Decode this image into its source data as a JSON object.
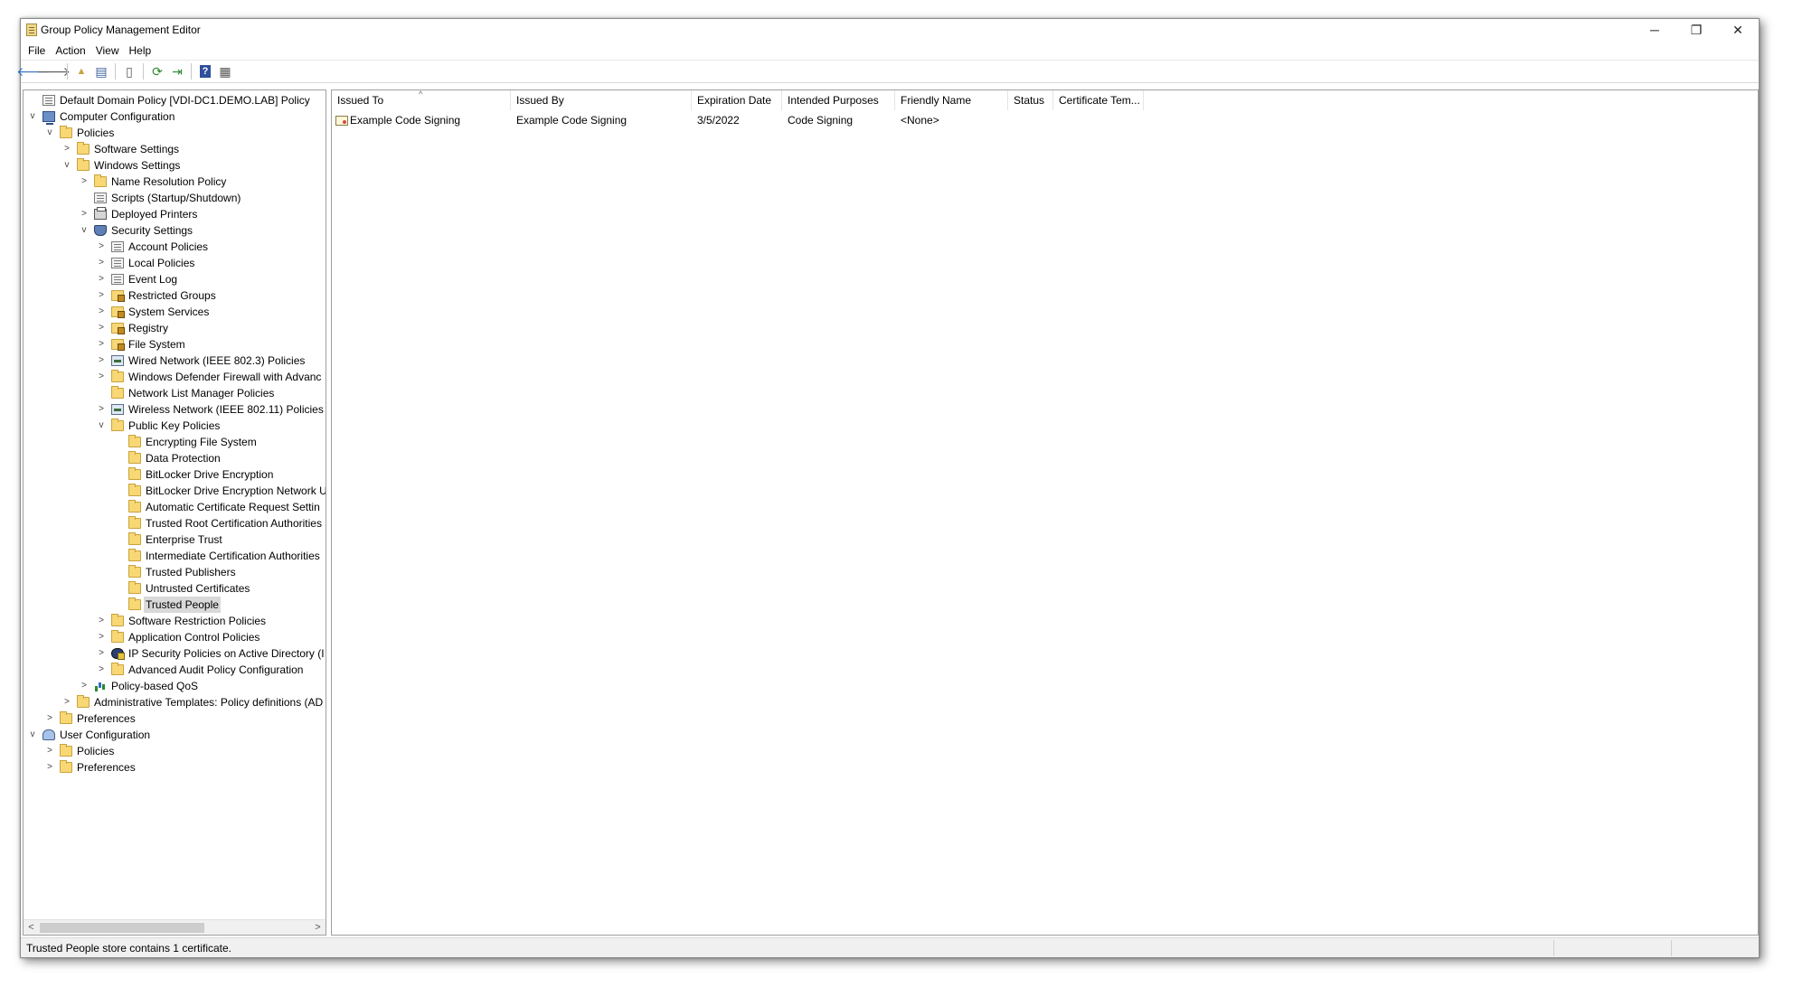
{
  "window": {
    "title": "Group Policy Management Editor",
    "controls": {
      "minimize": "─",
      "maximize": "❐",
      "close": "✕"
    }
  },
  "menu": {
    "file": "File",
    "action": "Action",
    "view": "View",
    "help": "Help"
  },
  "toolbar": {
    "back": "🡐",
    "forward": "🡒",
    "up": "▲",
    "show_tree": "▤",
    "properties": "▯",
    "refresh": "⟳",
    "export": "⇥",
    "help": "?",
    "view": "▦"
  },
  "tree": [
    {
      "label": "Default Domain Policy [VDI-DC1.DEMO.LAB] Policy",
      "icon": "doc",
      "depth": 0,
      "expander": ""
    },
    {
      "label": "Computer Configuration",
      "icon": "computer",
      "depth": 0,
      "expander": "v"
    },
    {
      "label": "Policies",
      "icon": "folder",
      "depth": 1,
      "expander": "v"
    },
    {
      "label": "Software Settings",
      "icon": "folder",
      "depth": 2,
      "expander": ">"
    },
    {
      "label": "Windows Settings",
      "icon": "folder",
      "depth": 2,
      "expander": "v"
    },
    {
      "label": "Name Resolution Policy",
      "icon": "folder",
      "depth": 3,
      "expander": ">"
    },
    {
      "label": "Scripts (Startup/Shutdown)",
      "icon": "doc",
      "depth": 3,
      "expander": ""
    },
    {
      "label": "Deployed Printers",
      "icon": "printer",
      "depth": 3,
      "expander": ">"
    },
    {
      "label": "Security Settings",
      "icon": "shield",
      "depth": 3,
      "expander": "v"
    },
    {
      "label": "Account Policies",
      "icon": "doc",
      "depth": 4,
      "expander": ">"
    },
    {
      "label": "Local Policies",
      "icon": "doc",
      "depth": 4,
      "expander": ">"
    },
    {
      "label": "Event Log",
      "icon": "doc",
      "depth": 4,
      "expander": ">"
    },
    {
      "label": "Restricted Groups",
      "icon": "lockfolder",
      "depth": 4,
      "expander": ">"
    },
    {
      "label": "System Services",
      "icon": "lockfolder",
      "depth": 4,
      "expander": ">"
    },
    {
      "label": "Registry",
      "icon": "lockfolder",
      "depth": 4,
      "expander": ">"
    },
    {
      "label": "File System",
      "icon": "lockfolder",
      "depth": 4,
      "expander": ">"
    },
    {
      "label": "Wired Network (IEEE 802.3) Policies",
      "icon": "net",
      "depth": 4,
      "expander": ">"
    },
    {
      "label": "Windows Defender Firewall with Advanc",
      "icon": "folder",
      "depth": 4,
      "expander": ">"
    },
    {
      "label": "Network List Manager Policies",
      "icon": "folder",
      "depth": 4,
      "expander": ""
    },
    {
      "label": "Wireless Network (IEEE 802.11) Policies",
      "icon": "net",
      "depth": 4,
      "expander": ">"
    },
    {
      "label": "Public Key Policies",
      "icon": "folder",
      "depth": 4,
      "expander": "v"
    },
    {
      "label": "Encrypting File System",
      "icon": "folder",
      "depth": 5,
      "expander": ""
    },
    {
      "label": "Data Protection",
      "icon": "folder",
      "depth": 5,
      "expander": ""
    },
    {
      "label": "BitLocker Drive Encryption",
      "icon": "folder",
      "depth": 5,
      "expander": ""
    },
    {
      "label": "BitLocker Drive Encryption Network U",
      "icon": "folder",
      "depth": 5,
      "expander": ""
    },
    {
      "label": "Automatic Certificate Request Settin",
      "icon": "folder",
      "depth": 5,
      "expander": ""
    },
    {
      "label": "Trusted Root Certification Authorities",
      "icon": "folder",
      "depth": 5,
      "expander": ""
    },
    {
      "label": "Enterprise Trust",
      "icon": "folder",
      "depth": 5,
      "expander": ""
    },
    {
      "label": "Intermediate Certification Authorities",
      "icon": "folder",
      "depth": 5,
      "expander": ""
    },
    {
      "label": "Trusted Publishers",
      "icon": "folder",
      "depth": 5,
      "expander": ""
    },
    {
      "label": "Untrusted Certificates",
      "icon": "folder",
      "depth": 5,
      "expander": ""
    },
    {
      "label": "Trusted People",
      "icon": "folder",
      "depth": 5,
      "expander": "",
      "selected": true
    },
    {
      "label": "Software Restriction Policies",
      "icon": "folder",
      "depth": 4,
      "expander": ">"
    },
    {
      "label": "Application Control Policies",
      "icon": "folder",
      "depth": 4,
      "expander": ">"
    },
    {
      "label": "IP Security Policies on Active Directory (I",
      "icon": "ipsec",
      "depth": 4,
      "expander": ">"
    },
    {
      "label": "Advanced Audit Policy Configuration",
      "icon": "folder",
      "depth": 4,
      "expander": ">"
    },
    {
      "label": "Policy-based QoS",
      "icon": "chart",
      "depth": 3,
      "expander": ">"
    },
    {
      "label": "Administrative Templates: Policy definitions (AD",
      "icon": "folder",
      "depth": 2,
      "expander": ">"
    },
    {
      "label": "Preferences",
      "icon": "folder",
      "depth": 1,
      "expander": ">"
    },
    {
      "label": "User Configuration",
      "icon": "user",
      "depth": 0,
      "expander": "v"
    },
    {
      "label": "Policies",
      "icon": "folder",
      "depth": 1,
      "expander": ">"
    },
    {
      "label": "Preferences",
      "icon": "folder",
      "depth": 1,
      "expander": ">"
    }
  ],
  "tree_scroll": {
    "left": "<",
    "right": ">"
  },
  "list": {
    "sort_indicator": "^",
    "columns": [
      "Issued To",
      "Issued By",
      "Expiration Date",
      "Intended Purposes",
      "Friendly Name",
      "Status",
      "Certificate Tem..."
    ],
    "rows": [
      [
        "Example Code Signing",
        "Example Code Signing",
        "3/5/2022",
        "Code Signing",
        "<None>",
        "",
        ""
      ]
    ]
  },
  "status": {
    "text": "Trusted People store contains 1 certificate."
  }
}
